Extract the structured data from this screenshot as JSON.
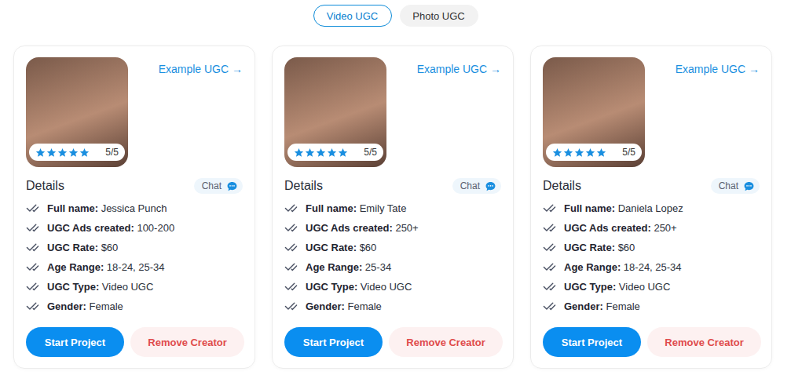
{
  "toggle": [
    {
      "label": "Video UGC",
      "selected": true
    },
    {
      "label": "Photo UGC",
      "selected": false
    }
  ],
  "creators": [
    {
      "example_link": "Example UGC →",
      "stars": 5,
      "rating": "5/5",
      "details_title": "Details",
      "chat": "Chat",
      "fields": [
        {
          "label": "Full name:",
          "value": "Jessica Punch"
        },
        {
          "label": "UGC Ads created:",
          "value": "100-200"
        },
        {
          "label": "UGC Rate:",
          "value": "$60"
        },
        {
          "label": "Age Range:",
          "value": "18-24, 25-34"
        },
        {
          "label": "UGC Type:",
          "value": "Video UGC"
        },
        {
          "label": "Gender:",
          "value": "Female"
        }
      ],
      "buttons": {
        "start": "Start Project",
        "remove": "Remove Creator"
      }
    },
    {
      "example_link": "Example UGC →",
      "stars": 5,
      "rating": "5/5",
      "details_title": "Details",
      "chat": "Chat",
      "fields": [
        {
          "label": "Full name:",
          "value": "Emily Tate"
        },
        {
          "label": "UGC Ads created:",
          "value": "250+"
        },
        {
          "label": "UGC Rate:",
          "value": "$60"
        },
        {
          "label": "Age Range:",
          "value": "25-34"
        },
        {
          "label": "UGC Type:",
          "value": "Video UGC"
        },
        {
          "label": "Gender:",
          "value": "Female"
        }
      ],
      "buttons": {
        "start": "Start Project",
        "remove": "Remove Creator"
      }
    },
    {
      "example_link": "Example UGC →",
      "stars": 5,
      "rating": "5/5",
      "details_title": "Details",
      "chat": "Chat",
      "fields": [
        {
          "label": "Full name:",
          "value": "Daniela Lopez"
        },
        {
          "label": "UGC Ads created:",
          "value": "250+"
        },
        {
          "label": "UGC Rate:",
          "value": "$60"
        },
        {
          "label": "Age Range:",
          "value": "18-24, 25-34"
        },
        {
          "label": "UGC Type:",
          "value": "Video UGC"
        },
        {
          "label": "Gender:",
          "value": "Female"
        }
      ],
      "buttons": {
        "start": "Start Project",
        "remove": "Remove Creator"
      }
    }
  ]
}
